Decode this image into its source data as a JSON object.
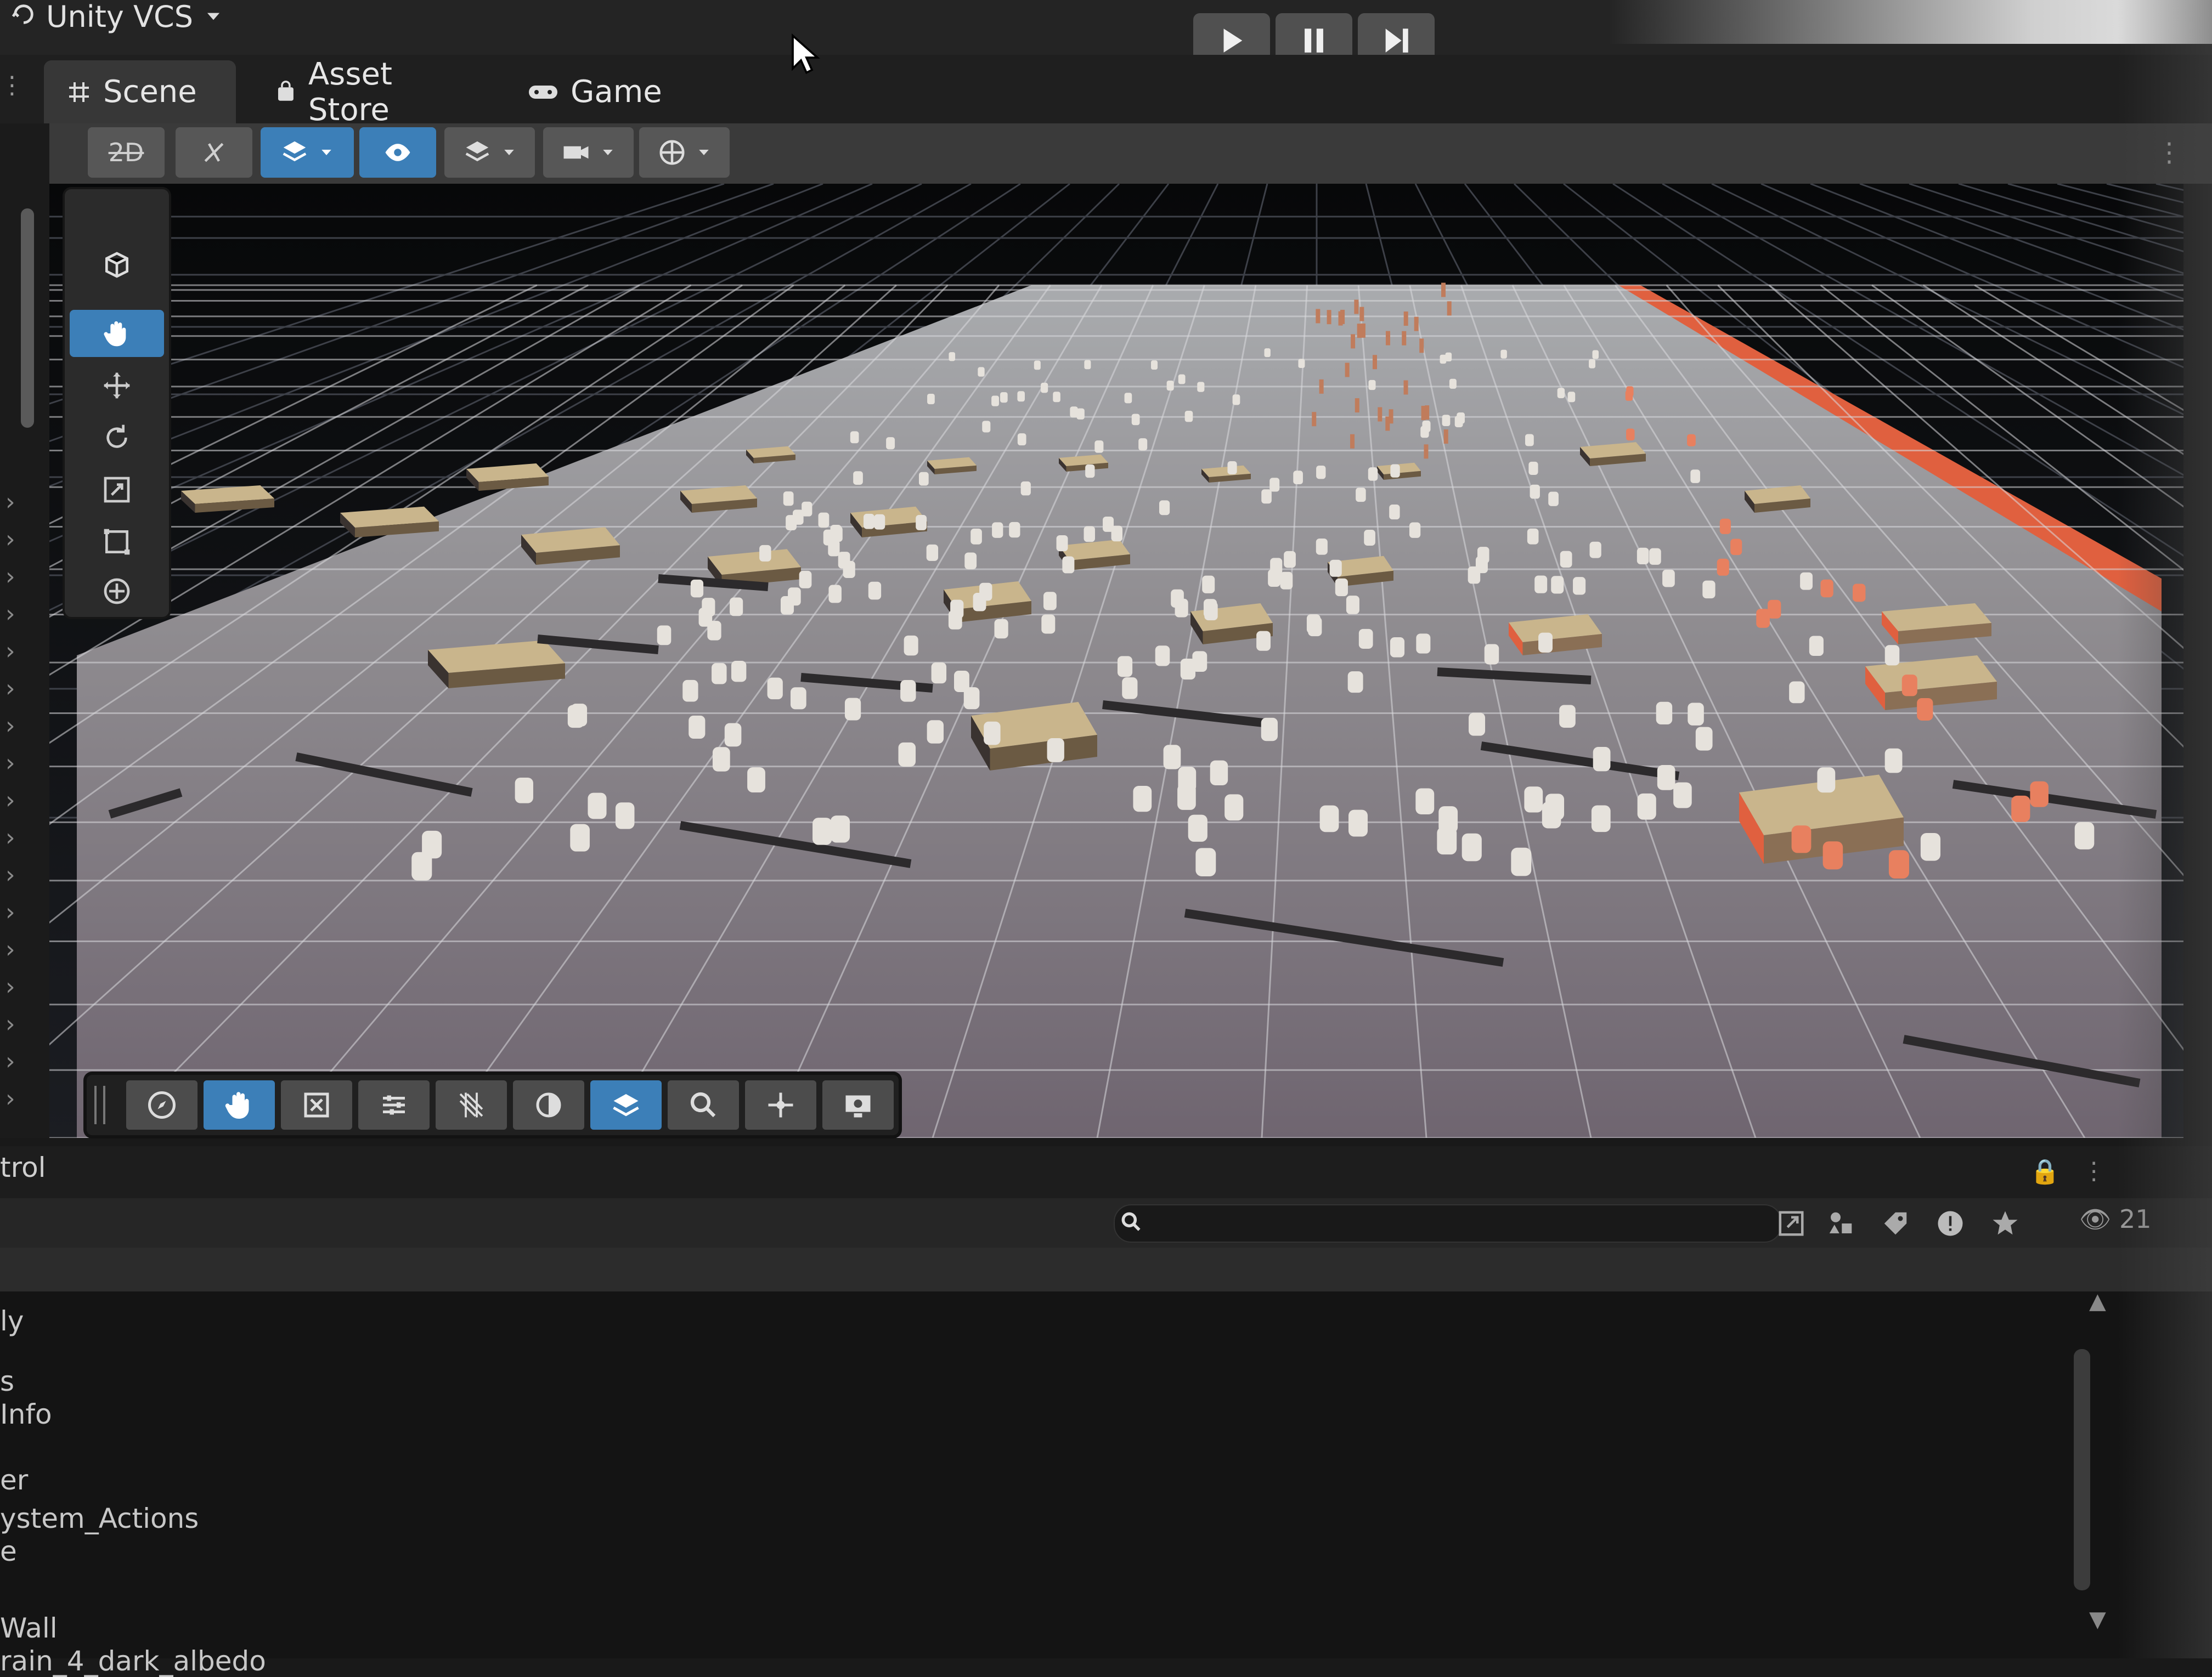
{
  "titlebar": {
    "vcs_label": "Unity VCS",
    "icons": [
      "vcs-icon",
      "chevron-down-icon"
    ],
    "playback": [
      {
        "name": "play-icon"
      },
      {
        "name": "pause-icon"
      },
      {
        "name": "step-icon"
      }
    ]
  },
  "tabs": [
    {
      "label": "Scene",
      "icon": "grid-icon",
      "active": true
    },
    {
      "label": "Asset Store",
      "icon": "shopping-bag-icon",
      "active": false
    },
    {
      "label": "Game",
      "icon": "gamepad-icon",
      "active": false
    }
  ],
  "scene_toolbar": {
    "toggle_2d_label": "2D",
    "buttons": [
      "2d-toggle",
      "lighting-toggle",
      "draw-mode-dropdown",
      "visibility-toggle",
      "layers-dropdown",
      "camera-dropdown",
      "gizmos-dropdown"
    ]
  },
  "tool_palette": [
    "view-cube-icon",
    "hand-tool-icon",
    "move-tool-icon",
    "rotate-tool-icon",
    "scale-tool-icon",
    "rect-tool-icon",
    "transform-tool-icon"
  ],
  "bottom_toolbar": [
    "compass-icon",
    "hand-icon",
    "frame-icon",
    "sliders-icon",
    "grid-hatch-icon",
    "circle-icon",
    "layers-icon",
    "search-icon",
    "move-icon",
    "camera-icon"
  ],
  "panel": {
    "title": "trol",
    "search_placeholder": "",
    "count": "21",
    "items": [
      "ly",
      "s",
      "Info",
      "er",
      "ystem_Actions",
      "e",
      "Wall",
      "rain_4_dark_albedo"
    ]
  },
  "colors": {
    "accent": "#3c7fb8",
    "panel_bg": "#1f1f1f",
    "toolbar_bg": "#3a3a3a",
    "border_highlight": "#e25a3a"
  }
}
